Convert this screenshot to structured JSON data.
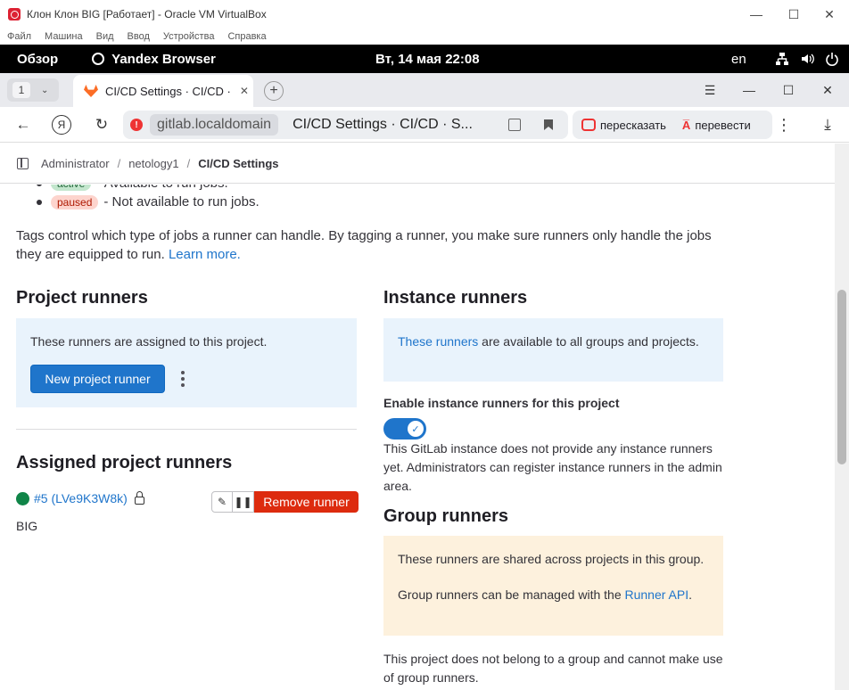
{
  "vbox": {
    "title": "Клон Клон BIG [Работает] - Oracle VM VirtualBox",
    "menu": [
      "Файл",
      "Машина",
      "Вид",
      "Ввод",
      "Устройства",
      "Справка"
    ]
  },
  "gnome": {
    "overview": "Обзор",
    "app": "Yandex Browser",
    "clock": "Вт, 14 мая  22:08",
    "lang": "en"
  },
  "browser": {
    "tab_count": "1",
    "tab_title": "CI/CD Settings · CI/CD ·",
    "domain": "gitlab.localdomain",
    "page_title": "CI/CD Settings · CI/CD · S...",
    "retell": "пересказать",
    "translate": "перевести"
  },
  "breadcrumb": [
    "Administrator",
    "netology1",
    "CI/CD Settings"
  ],
  "statuses": {
    "active_badge": "active",
    "active_text": "- Available to run jobs.",
    "paused_badge": "paused",
    "paused_text": "- Not available to run jobs."
  },
  "tags_text": "Tags control which type of jobs a runner can handle. By tagging a runner, you make sure runners only handle the jobs they are equipped to run.",
  "learn_more": "Learn more.",
  "project_runners": {
    "title": "Project runners",
    "info": "These runners are assigned to this project.",
    "new_button": "New project runner",
    "assigned_title": "Assigned project runners",
    "runner_id": "#5 (LVe9K3W8k)",
    "runner_desc": "BIG",
    "remove_button": "Remove runner"
  },
  "instance_runners": {
    "title": "Instance runners",
    "info_link": "These runners",
    "info_rest": " are available to all groups and projects.",
    "enable_label": "Enable instance runners for this project",
    "note": "This GitLab instance does not provide any instance runners yet. Administrators can register instance runners in the admin area."
  },
  "group_runners": {
    "title": "Group runners",
    "shared": "These runners are shared across projects in this group.",
    "managed_prefix": "Group runners can be managed with the ",
    "managed_link": "Runner API",
    "managed_suffix": ".",
    "note": "This project does not belong to a group and cannot make use of group runners."
  },
  "colors": {
    "accent": "#1f75cb",
    "danger": "#dd2b0e",
    "online": "#108548",
    "info_bg": "#e9f3fc",
    "warn_bg": "#fdf1dd"
  }
}
